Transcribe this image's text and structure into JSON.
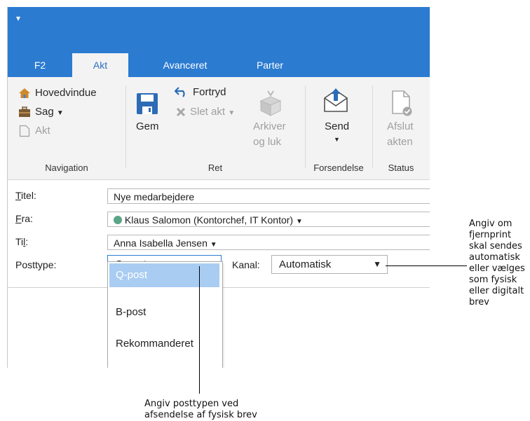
{
  "tabs": [
    {
      "label": "F2",
      "active": false
    },
    {
      "label": "Akt",
      "active": true
    },
    {
      "label": "Avanceret",
      "active": false
    },
    {
      "label": "Parter",
      "active": false
    }
  ],
  "ribbon": {
    "navigation": {
      "hovedvindue": "Hovedvindue",
      "sag": "Sag",
      "akt": "Akt",
      "group_label": "Navigation"
    },
    "ret": {
      "gem": "Gem",
      "fortryd": "Fortryd",
      "slet_akt": "Slet akt",
      "arkiver_line1": "Arkiver",
      "arkiver_line2": "og luk",
      "group_label": "Ret"
    },
    "forsendelse": {
      "send": "Send",
      "group_label": "Forsendelse"
    },
    "status": {
      "afslut_line1": "Afslut",
      "afslut_line2": "akten",
      "group_label": "Status"
    }
  },
  "form": {
    "titel": {
      "label_u": "T",
      "label_rest": "itel:",
      "value": "Nye medarbejdere"
    },
    "fra": {
      "label_u": "F",
      "label_rest": "ra:",
      "value": "Klaus Salomon (Kontorchef, IT Kontor)"
    },
    "til": {
      "label_pre": "Ti",
      "label_u": "l",
      "label_rest": ":",
      "value": "Anna Isabella Jensen"
    },
    "posttype": {
      "label": "Posttype:",
      "value": "Q-post",
      "options": [
        "Q-post",
        "B-post",
        "Rekommanderet"
      ]
    },
    "kanal": {
      "label": "Kanal:",
      "value": "Automatisk"
    }
  },
  "colors": {
    "titlebar": "#2b7bd1",
    "ribbon_bg": "#f3f3f3",
    "dropdown_selected": "#a9cdf2",
    "status_dot": "#5aa587"
  },
  "callouts": {
    "right": [
      "Angiv om",
      "fjernprint",
      "skal sendes",
      "automatisk",
      "eller vælges",
      "som fysisk",
      "eller digitalt",
      "brev"
    ],
    "bottom": [
      "Angiv posttypen ved",
      "afsendelse af fysisk brev"
    ]
  }
}
